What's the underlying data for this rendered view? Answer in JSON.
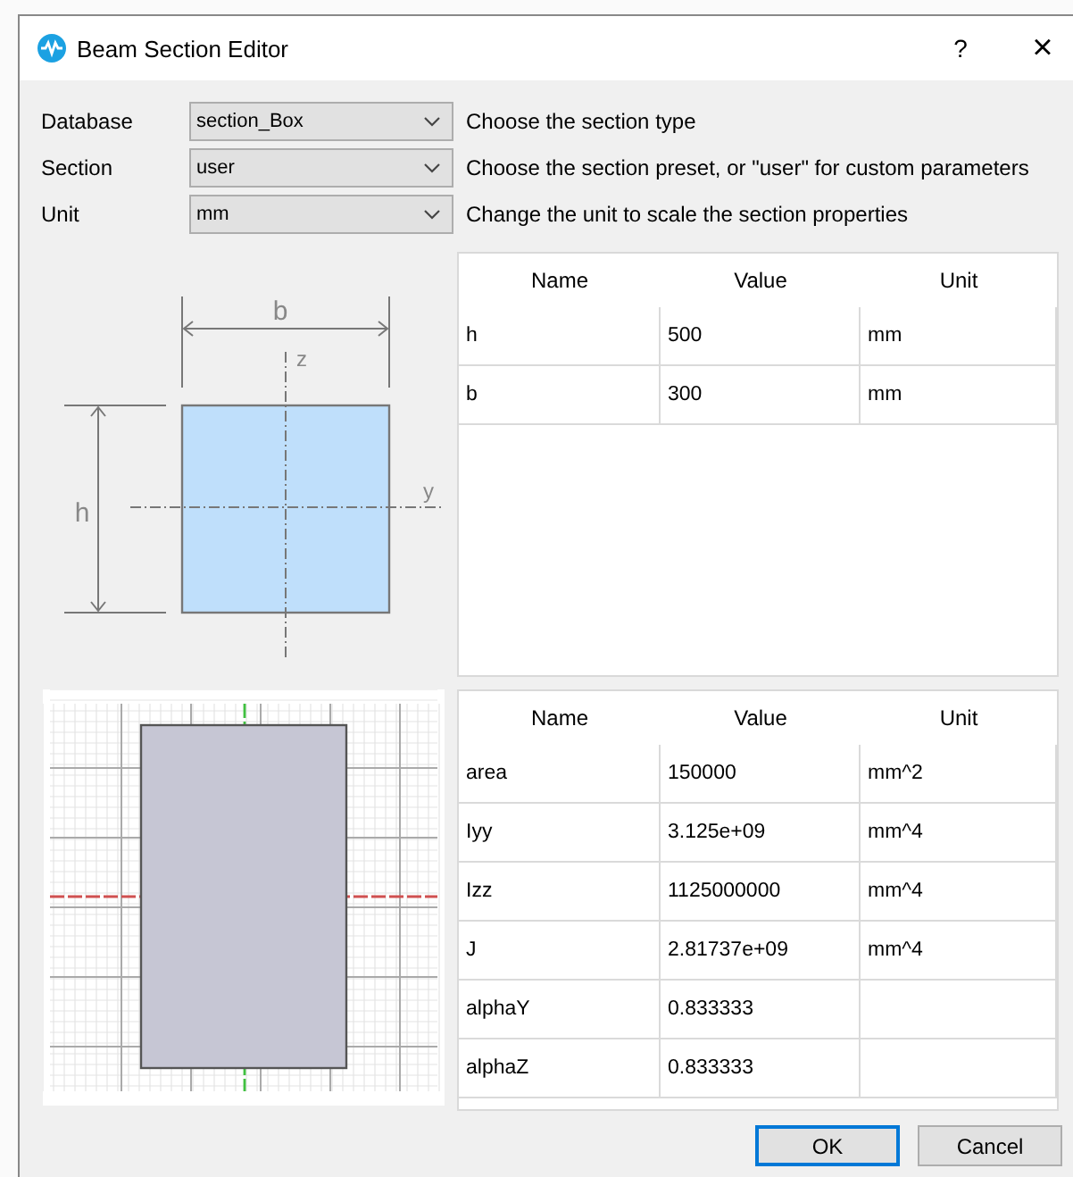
{
  "window": {
    "title": "Beam Section Editor",
    "help": "?",
    "close": "×"
  },
  "fields": [
    {
      "label": "Database",
      "value": "section_Box",
      "hint": "Choose the section type"
    },
    {
      "label": "Section",
      "value": "user",
      "hint": "Choose the section preset, or \"user\" for custom parameters"
    },
    {
      "label": "Unit",
      "value": "mm",
      "hint": "Change the unit to scale the section properties"
    }
  ],
  "diagram": {
    "width_label": "b",
    "height_label": "h",
    "z_axis": "z",
    "y_axis": "y"
  },
  "parameters": {
    "columns": [
      "Name",
      "Value",
      "Unit"
    ],
    "rows": [
      [
        "h",
        "500",
        "mm"
      ],
      [
        "b",
        "300",
        "mm"
      ]
    ]
  },
  "properties": {
    "columns": [
      "Name",
      "Value",
      "Unit"
    ],
    "rows": [
      [
        "area",
        "150000",
        "mm^2"
      ],
      [
        "Iyy",
        "3.125e+09",
        "mm^4"
      ],
      [
        "Izz",
        "1125000000",
        "mm^4"
      ],
      [
        "J",
        "2.81737e+09",
        "mm^4"
      ],
      [
        "alphaY",
        "0.833333",
        ""
      ],
      [
        "alphaZ",
        "0.833333",
        ""
      ]
    ]
  },
  "buttons": [
    {
      "label": "OK",
      "default": true
    },
    {
      "label": "Cancel",
      "default": false
    }
  ]
}
